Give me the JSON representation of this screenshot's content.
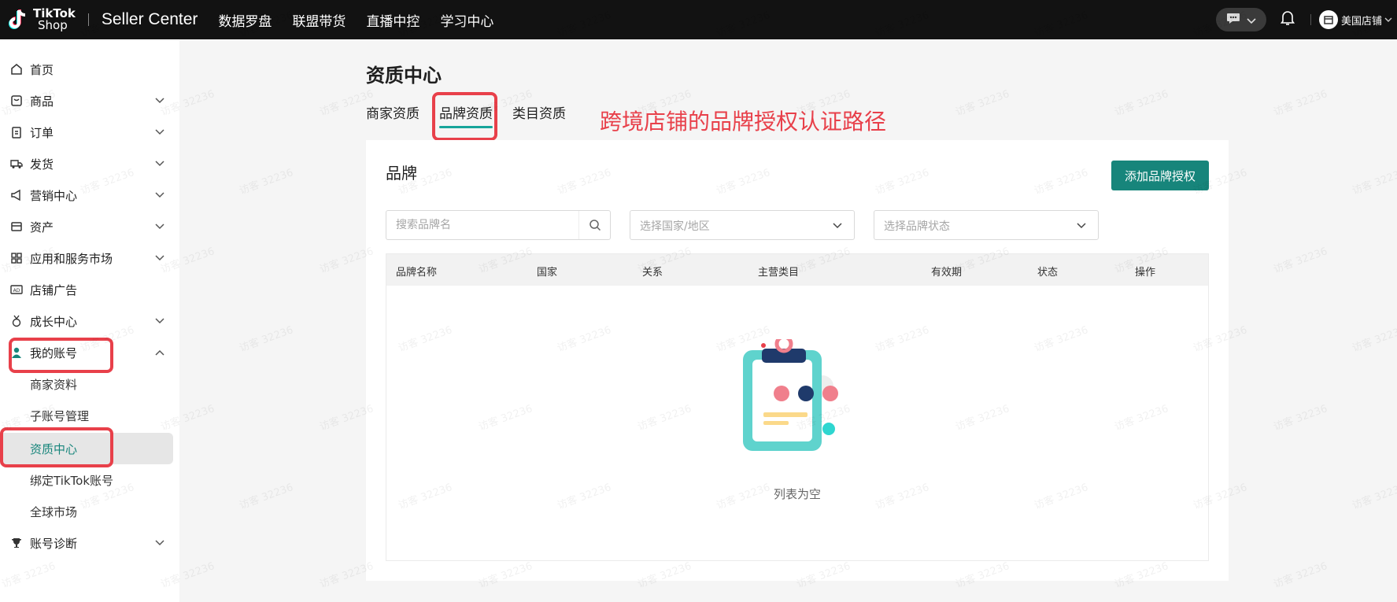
{
  "topbar": {
    "logo_line1": "TikTok",
    "logo_line2": "Shop",
    "title": "Seller Center",
    "nav": [
      "数据罗盘",
      "联盟带货",
      "直播中控",
      "学习中心"
    ],
    "store_name": "美国店铺"
  },
  "sidebar": {
    "items": [
      {
        "label": "首页",
        "icon": "home-icon"
      },
      {
        "label": "商品",
        "icon": "product-box-icon"
      },
      {
        "label": "订单",
        "icon": "clipboard-icon"
      },
      {
        "label": "发货",
        "icon": "truck-icon"
      },
      {
        "label": "营销中心",
        "icon": "megaphone-icon"
      },
      {
        "label": "资产",
        "icon": "wallet-icon"
      },
      {
        "label": "应用和服务市场",
        "icon": "apps-grid-icon"
      },
      {
        "label": "店铺广告",
        "icon": "ad-icon"
      },
      {
        "label": "成长中心",
        "icon": "medal-icon"
      },
      {
        "label": "我的账号",
        "icon": "user-icon"
      },
      {
        "label": "账号诊断",
        "icon": "trophy-icon"
      }
    ],
    "sub_items": [
      "商家资料",
      "子账号管理",
      "资质中心",
      "绑定TikTok账号",
      "全球市场"
    ]
  },
  "main": {
    "page_title": "资质中心",
    "tabs": [
      "商家资质",
      "品牌资质",
      "类目资质"
    ],
    "annotation": "跨境店铺的品牌授权认证路径",
    "card_title": "品牌",
    "add_button": "添加品牌授权",
    "search_placeholder": "搜索品牌名",
    "country_placeholder": "选择国家/地区",
    "status_placeholder": "选择品牌状态",
    "columns": [
      "品牌名称",
      "国家",
      "关系",
      "主营类目",
      "有效期",
      "状态",
      "操作"
    ],
    "empty_text": "列表为空"
  },
  "watermark_text": "访客 32236",
  "colors": {
    "accent": "#17857b",
    "tab_underline": "#17a59a",
    "annotation_red": "#e8404a",
    "topbar_bg": "#121212"
  }
}
